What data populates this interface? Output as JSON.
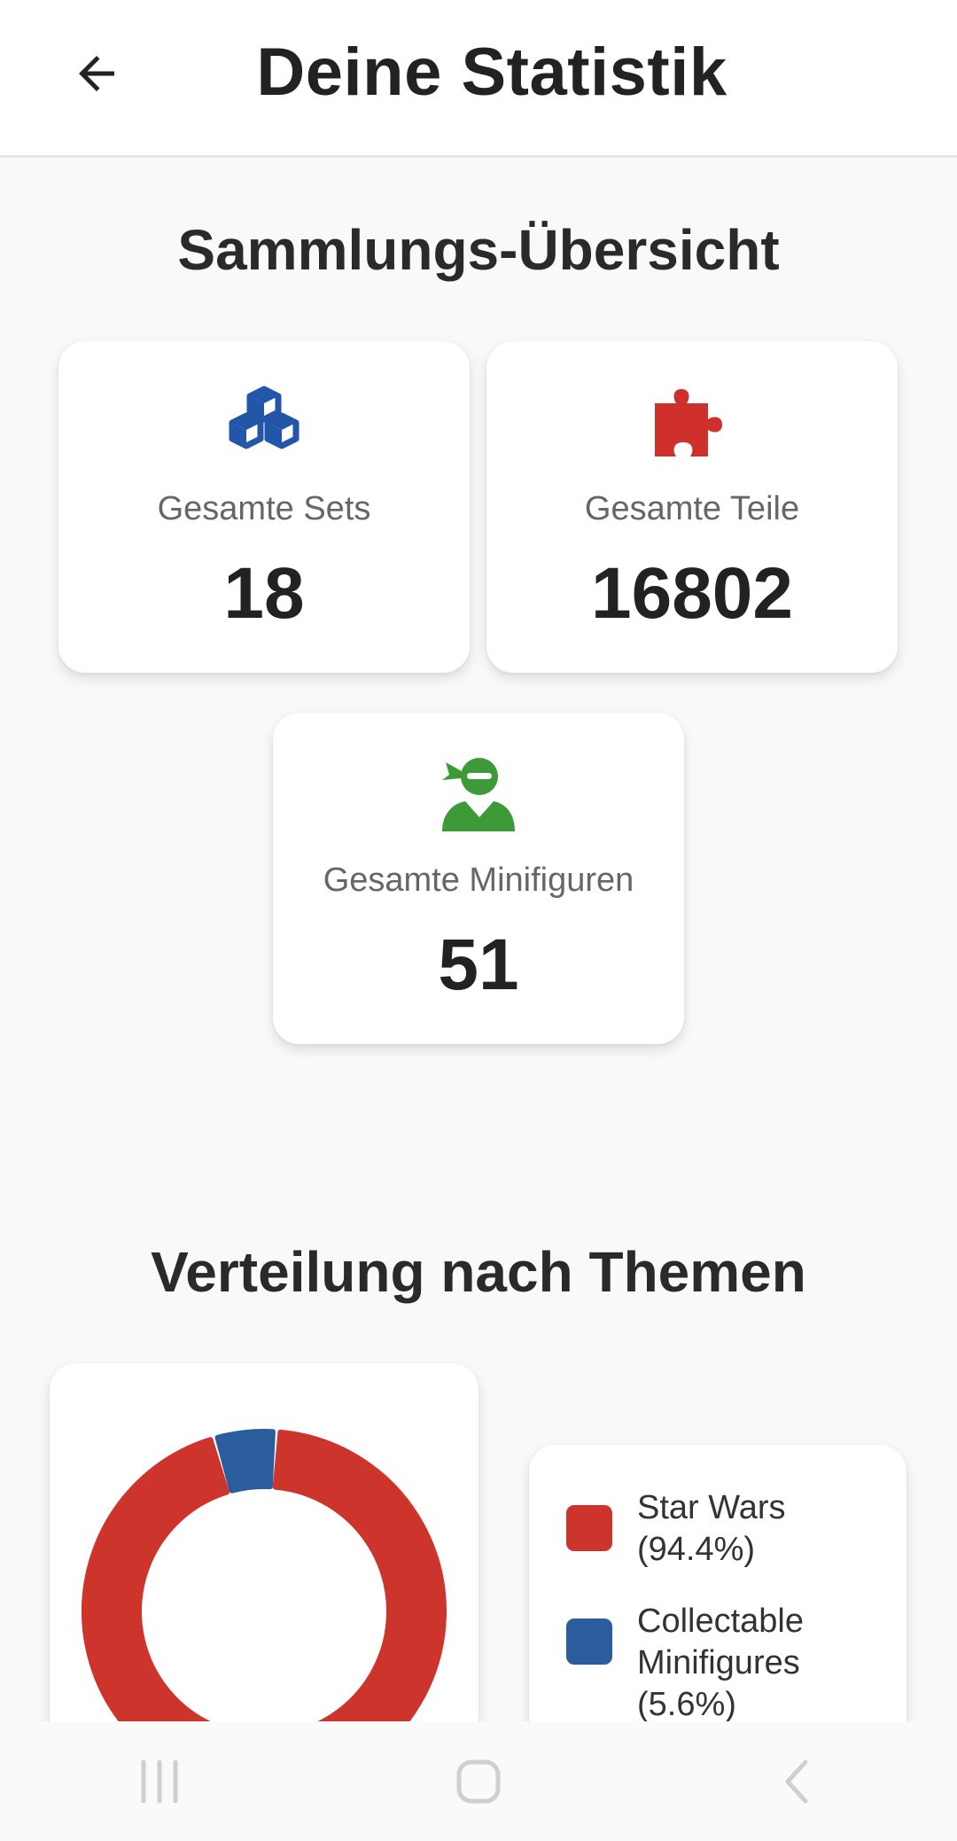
{
  "header": {
    "title": "Deine Statistik",
    "back_icon": "arrow-left-icon"
  },
  "overview": {
    "title": "Sammlungs-Übersicht",
    "cards": [
      {
        "label": "Gesamte Sets",
        "value": "18",
        "icon": "cubes-icon",
        "color": "#2355a8"
      },
      {
        "label": "Gesamte Teile",
        "value": "16802",
        "icon": "puzzle-piece-icon",
        "color": "#d0302b"
      },
      {
        "label": "Gesamte Minifiguren",
        "value": "51",
        "icon": "ninja-icon",
        "color": "#3e9a36"
      }
    ]
  },
  "themes": {
    "title": "Verteilung nach Themen",
    "legend": [
      {
        "label": "Star Wars (94.4%)",
        "color": "#cc342c"
      },
      {
        "label": "Collectable Minifigures (5.6%)",
        "color": "#2b5c9e"
      }
    ]
  },
  "chart_data": {
    "type": "pie",
    "style": "donut",
    "categories": [
      "Star Wars",
      "Collectable Minifigures"
    ],
    "values": [
      94.4,
      5.6
    ],
    "colors": [
      "#cc342c",
      "#2b5c9e"
    ],
    "title": ""
  },
  "navbar": {
    "icons": [
      "recent-apps-icon",
      "home-icon",
      "back-icon"
    ]
  }
}
